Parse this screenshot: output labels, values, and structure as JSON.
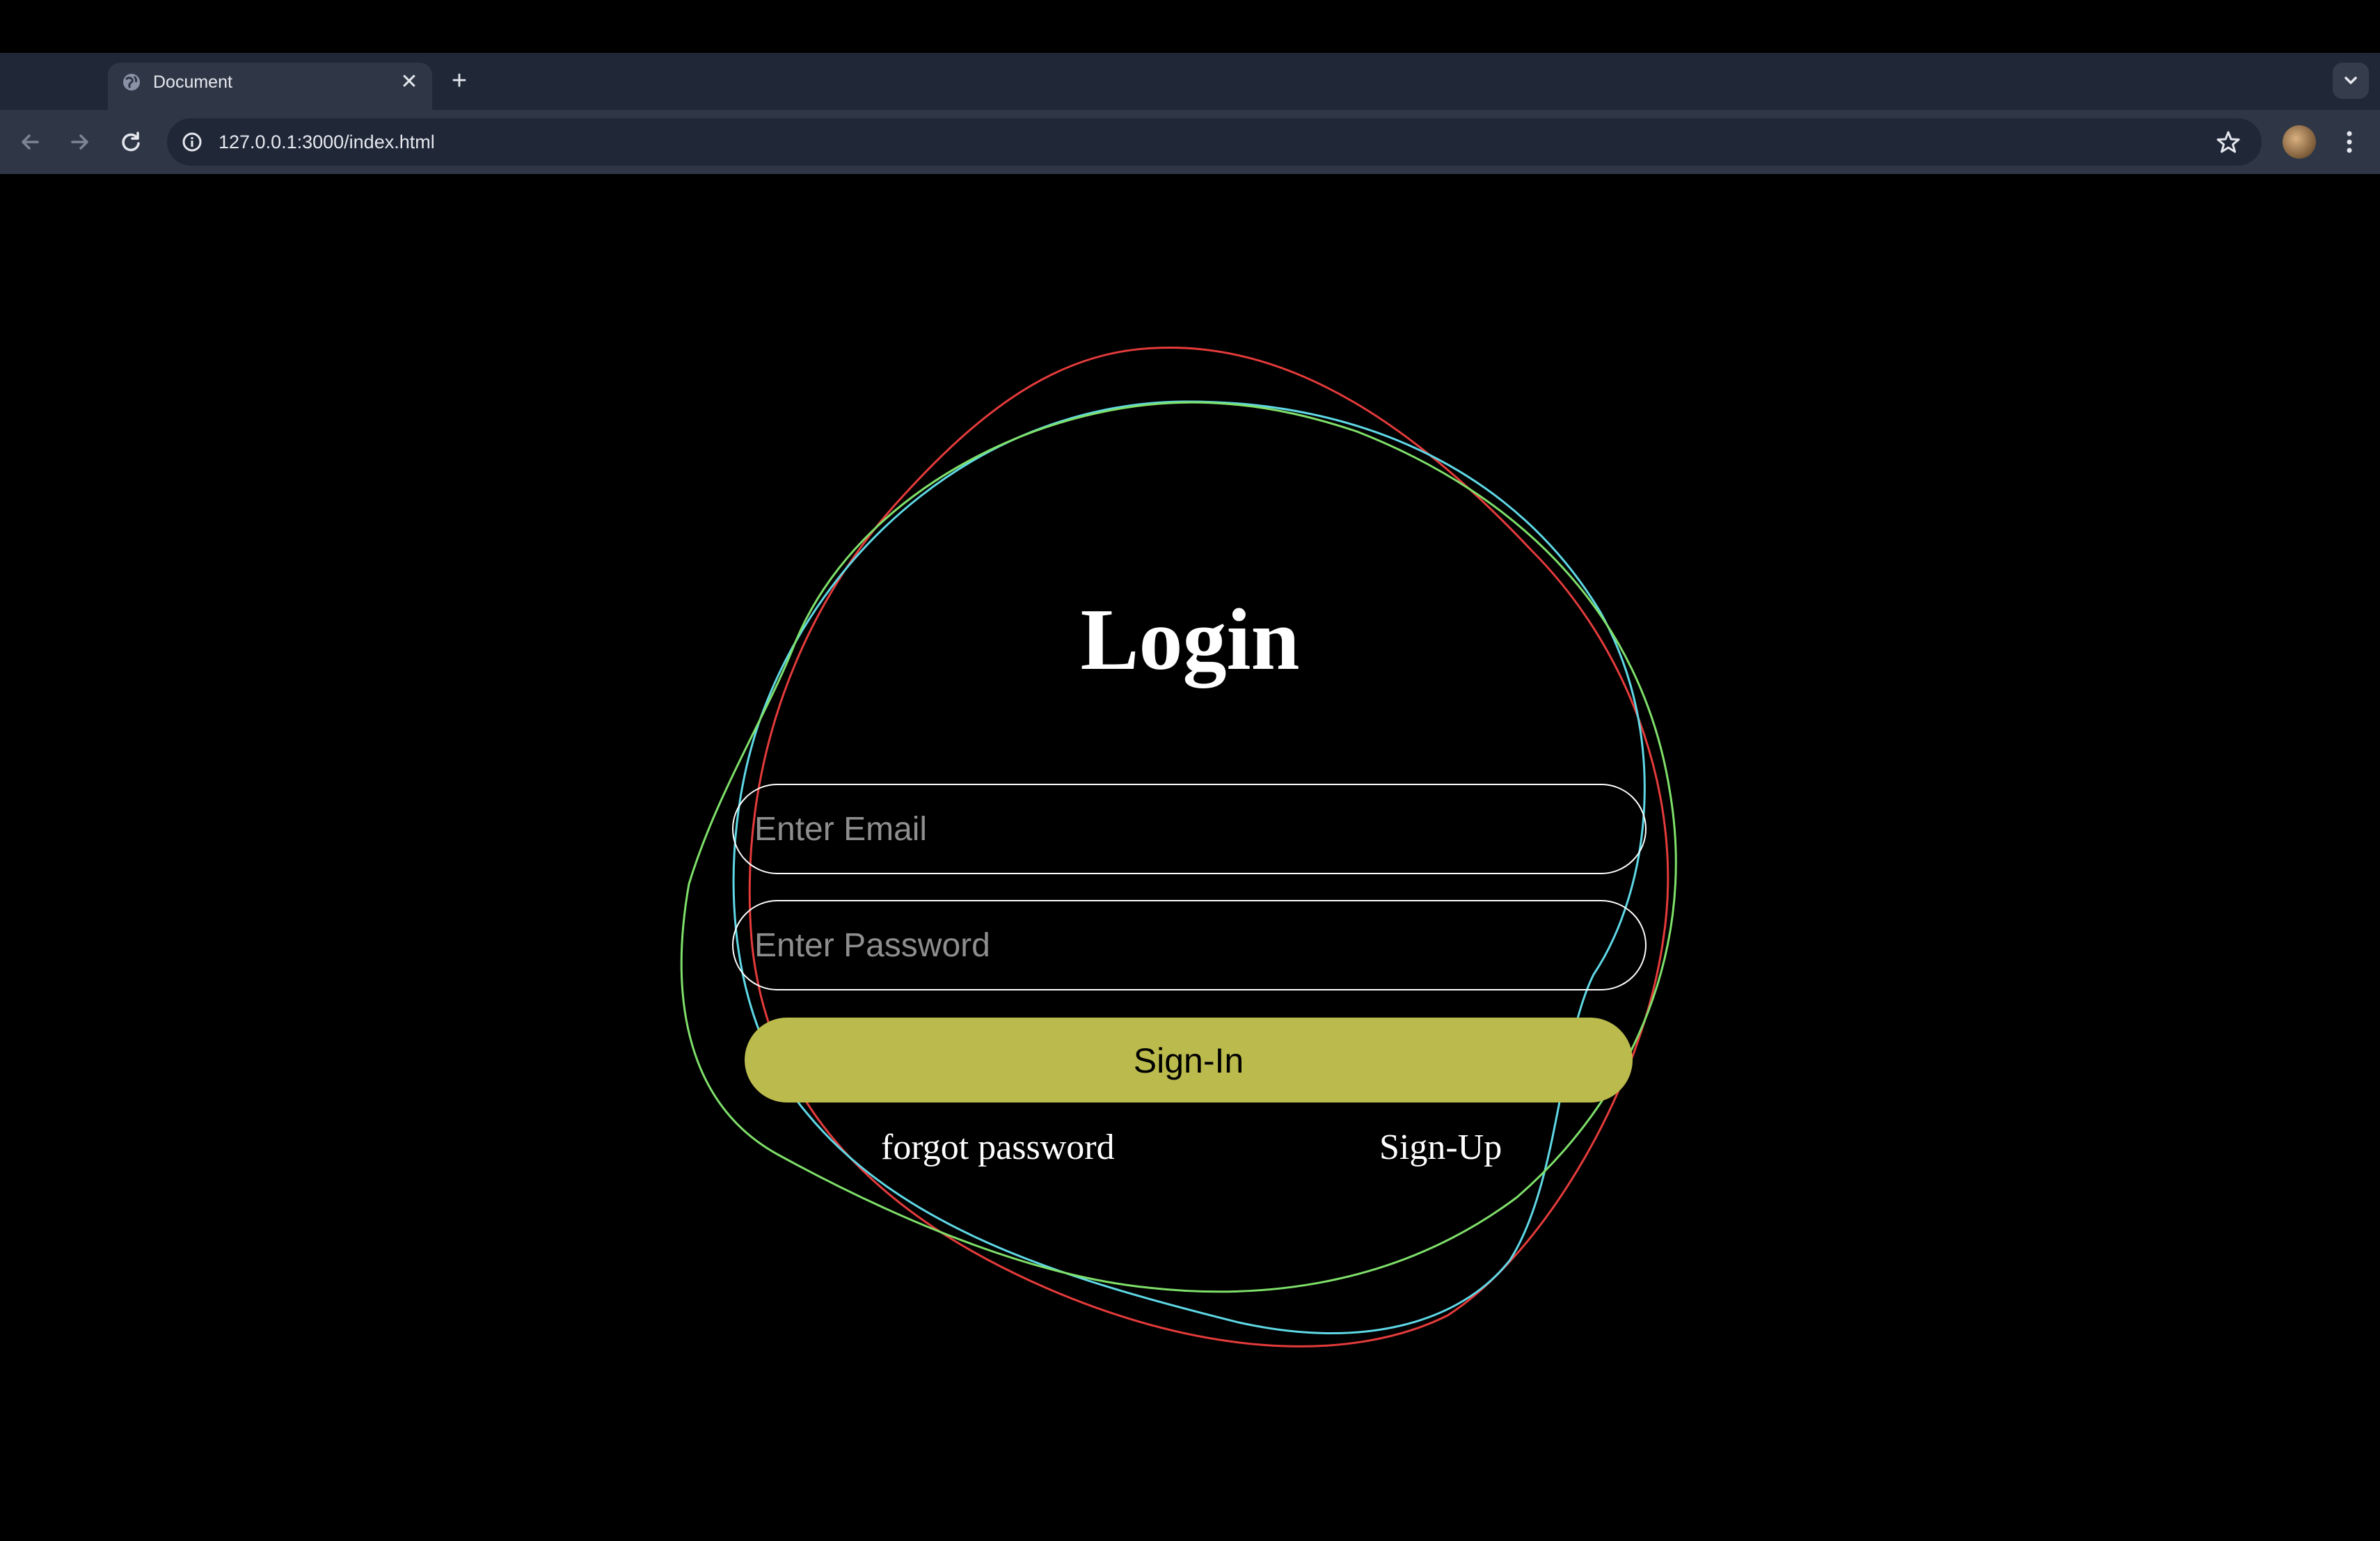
{
  "browser": {
    "tab": {
      "title": "Document",
      "close_glyph": "✕",
      "icon": "globe-icon"
    },
    "new_tab_glyph": "+",
    "address": "127.0.0.1:3000/index.html",
    "icons": [
      "back-icon",
      "forward-icon",
      "reload-icon",
      "site-info-icon",
      "star-icon",
      "profile-avatar",
      "more-menu-icon",
      "tab-dropdown-icon"
    ]
  },
  "login": {
    "title": "Login",
    "email_placeholder": "Enter Email",
    "password_placeholder": "Enter Password",
    "signin_label": "Sign-In",
    "forgot_label": "forgot password",
    "signup_label": "Sign-Up"
  },
  "colors": {
    "background": "#000000",
    "button": "#bbbb4d",
    "ring_red": "#e53b3b",
    "ring_cyan": "#5fd8e6",
    "ring_green": "#7fe06a"
  }
}
